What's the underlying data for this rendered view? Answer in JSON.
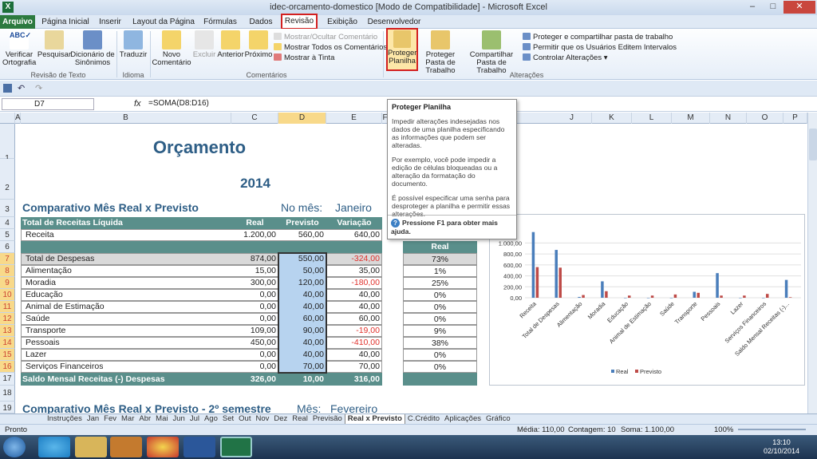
{
  "window": {
    "title": "idec-orcamento-domestico  [Modo de Compatibilidade]  -  Microsoft Excel",
    "app_icon": "X",
    "min": "–",
    "max": "□",
    "close": "✕"
  },
  "tabs": [
    "Arquivo",
    "Página Inicial",
    "Inserir",
    "Layout da Página",
    "Fórmulas",
    "Dados",
    "Revisão",
    "Exibição",
    "Desenvolvedor"
  ],
  "ribbon": {
    "verificar": "Verificar Ortografia",
    "pesquisar": "Pesquisar",
    "dicionario": "Dicionário de Sinônimos",
    "traduzir": "Traduzir",
    "novo": "Novo Comentário",
    "excluir": "Excluir",
    "anterior": "Anterior",
    "proximo": "Próximo",
    "mostrar_ocultar": "Mostrar/Ocultar Comentário",
    "mostrar_todos": "Mostrar Todos os Comentários",
    "mostrar_tinta": "Mostrar à Tinta",
    "proteger_planilha": "Proteger Planilha",
    "proteger_pasta": "Proteger Pasta de Trabalho",
    "compartilhar": "Compartilhar Pasta de Trabalho",
    "proteger_compartilhar": "Proteger e compartilhar pasta de trabalho",
    "permitir": "Permitir que os Usuários Editem Intervalos",
    "controlar": "Controlar Alterações ▾",
    "grp_revisao": "Revisão de Texto",
    "grp_idioma": "Idioma",
    "grp_comentarios": "Comentários",
    "grp_alteracoes": "Alterações"
  },
  "formula": {
    "cell": "D7",
    "fx": "fx",
    "value": "=SOMA(D8:D16)"
  },
  "columns": [
    "A",
    "B",
    "C",
    "D",
    "E",
    "F",
    "J",
    "K",
    "L",
    "M",
    "N",
    "O",
    "P"
  ],
  "rows": [
    "1",
    "2",
    "3",
    "4",
    "5",
    "6",
    "7",
    "8",
    "9",
    "10",
    "11",
    "12",
    "13",
    "14",
    "15",
    "16",
    "17",
    "18",
    "19"
  ],
  "sheet": {
    "title": "Orçamento",
    "year": "2014",
    "comp_title": "Comparativo  Mês Real x Previsto",
    "no_mes": "No mês:",
    "mes": "Janeiro",
    "hdr": [
      "Total de Receitas Líquida",
      "Real",
      "Previsto",
      "Variação"
    ],
    "receita": [
      "Receita",
      "1.200,00",
      "560,00",
      "640,00"
    ],
    "despesas": [
      [
        "Total de Despesas",
        "874,00",
        "550,00",
        "-324,00",
        "73%"
      ],
      [
        "Alimentação",
        "15,00",
        "50,00",
        "35,00",
        "1%"
      ],
      [
        "Moradia",
        "300,00",
        "120,00",
        "-180,00",
        "25%"
      ],
      [
        "Educação",
        "0,00",
        "40,00",
        "40,00",
        "0%"
      ],
      [
        "Animal de Estimação",
        "0,00",
        "40,00",
        "40,00",
        "0%"
      ],
      [
        "Saúde",
        "0,00",
        "60,00",
        "60,00",
        "0%"
      ],
      [
        "Transporte",
        "109,00",
        "90,00",
        "-19,00",
        "9%"
      ],
      [
        "Pessoais",
        "450,00",
        "40,00",
        "-410,00",
        "38%"
      ],
      [
        "Lazer",
        "0,00",
        "40,00",
        "40,00",
        "0%"
      ],
      [
        "Serviços Financeiros",
        "0,00",
        "70,00",
        "70,00",
        "0%"
      ]
    ],
    "saldo": [
      "Saldo Mensal Receitas (-) Despesas",
      "326,00",
      "10,00",
      "316,00"
    ],
    "real_hdr": "Real",
    "comp2_title": "Comparativo  Mês Real x Previsto - 2º semestre",
    "mes2_label": "Mês:",
    "mes2": "Fevereiro"
  },
  "tooltip": {
    "title": "Proteger Planilha",
    "p1": "Impedir alterações indesejadas nos dados de uma planilha especificando as informações que podem ser alteradas.",
    "p2": "Por exemplo, você pode impedir a edição de células bloqueadas ou a alteração da formatação do documento.",
    "p3": "É possível especificar uma senha para desproteger a planilha e permitir essas alterações.",
    "help": "Pressione F1 para obter mais ajuda."
  },
  "chart_data": {
    "type": "bar",
    "categories": [
      "Receita",
      "Total de Despesas",
      "Alimentação",
      "Moradia",
      "Educação",
      "Animal de Estimação",
      "Saúde",
      "Transporte",
      "Pessoais",
      "Lazer",
      "Serviços Financeiros",
      "Saldo Mensal Receitas (-)..."
    ],
    "series": [
      {
        "name": "Real",
        "color": "#4a7ebb",
        "values": [
          1200,
          874,
          15,
          300,
          0,
          0,
          0,
          109,
          450,
          0,
          0,
          326
        ]
      },
      {
        "name": "Previsto",
        "color": "#be4b48",
        "values": [
          560,
          550,
          50,
          120,
          40,
          40,
          60,
          90,
          40,
          40,
          70,
          10
        ]
      }
    ],
    "yticks": [
      "0,00",
      "200,00",
      "400,00",
      "600,00",
      "800,00",
      "1.000,00"
    ],
    "ylim": [
      0,
      1400
    ],
    "legend": "bottom"
  },
  "sheet_tabs": [
    "Instruções",
    "Jan",
    "Fev",
    "Mar",
    "Abr",
    "Mai",
    "Jun",
    "Jul",
    "Ago",
    "Set",
    "Out",
    "Nov",
    "Dez",
    "Real",
    "Previsão",
    "Real x Previsto",
    "C.Crédito",
    "Aplicações",
    "Gráfico"
  ],
  "status": {
    "mode": "Pronto",
    "media": "Média: 110,00",
    "contagem": "Contagem: 10",
    "soma": "Soma: 1.100,00",
    "zoom": "100%"
  },
  "clock": {
    "time": "13:10",
    "date": "02/10/2014"
  }
}
